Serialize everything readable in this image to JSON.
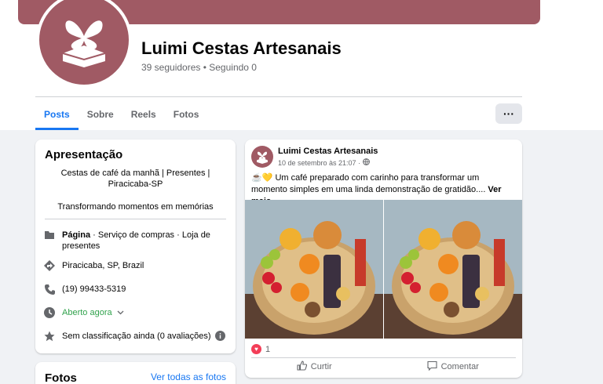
{
  "colors": {
    "brand": "#a05a64",
    "accent": "#1877f2",
    "open_green": "#31a24c",
    "heart": "#f33e58"
  },
  "profile": {
    "name": "Luimi Cestas Artesanais",
    "stats": "39 seguidores • Seguindo 0"
  },
  "tabs": [
    {
      "label": "Posts",
      "active": true
    },
    {
      "label": "Sobre"
    },
    {
      "label": "Reels"
    },
    {
      "label": "Fotos"
    }
  ],
  "more_button": {
    "label": "···"
  },
  "intro": {
    "title": "Apresentação",
    "bio": "Cestas de café da manhã | Presentes | Piracicaba-SP",
    "motto": "Transformando momentos em memórias",
    "page_type_bold": "Página",
    "page_type_rest": " · Serviço de compras · Loja de presentes",
    "location": "Piracicaba, SP, Brazil",
    "phone": "(19) 99433-5319",
    "hours": "Aberto agora",
    "rating": "Sem classificação ainda (0 avaliações)"
  },
  "photos": {
    "title": "Fotos",
    "see_all": "Ver todas as fotos"
  },
  "post": {
    "author": "Luimi Cestas Artesanais",
    "date": "10 de setembro às 21:07 ·",
    "emoji": "☕💛",
    "text": " Um café preparado com carinho para transformar um momento simples em uma linda demonstração de gratidão....",
    "see_more": " Ver mais",
    "reaction_count": "1",
    "like_label": "Curtir",
    "comment_label": "Comentar"
  }
}
